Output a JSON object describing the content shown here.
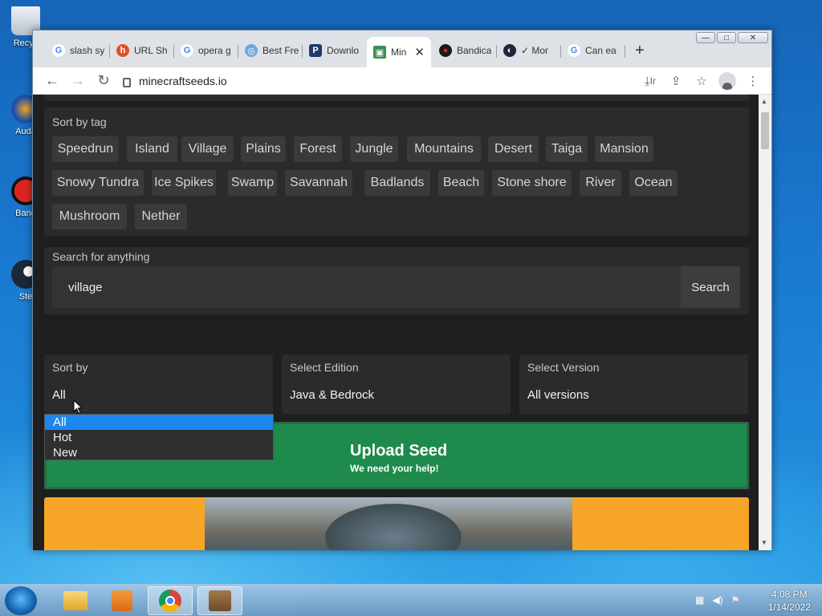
{
  "desktop": {
    "icons": [
      {
        "label": "Recyc",
        "color": "#dfe6ee"
      },
      {
        "label": "Auda",
        "color": "#1c4fa8"
      },
      {
        "label": "Band",
        "color": "#d8261f"
      },
      {
        "label": "Ste",
        "color": "#1b2838"
      }
    ]
  },
  "browser": {
    "tabs": [
      {
        "title": "slash sy",
        "icon": "google-icon",
        "glyph": "G",
        "color": "#ffffff",
        "fg": "#4285f4"
      },
      {
        "title": "URL Sh",
        "icon": "url-shortener-icon",
        "glyph": "h",
        "color": "#e0502a",
        "fg": "#ffffff"
      },
      {
        "title": "opera g",
        "icon": "google-icon",
        "glyph": "G",
        "color": "#ffffff",
        "fg": "#4285f4"
      },
      {
        "title": "Best Fre",
        "icon": "globe-icon",
        "glyph": "◎",
        "color": "#6aa6df",
        "fg": "#ffffff"
      },
      {
        "title": "Downlo",
        "icon": "pdf-icon",
        "glyph": "P",
        "color": "#1f3a6b",
        "fg": "#ffffff"
      },
      {
        "title": "Min",
        "icon": "minecraft-icon",
        "glyph": "▣",
        "color": "#3a8f55",
        "fg": "#ffffff",
        "active": true
      },
      {
        "title": "Bandica",
        "icon": "record-icon",
        "glyph": "●",
        "color": "#1a1a1a",
        "fg": "#e02020"
      },
      {
        "title": "✓ Mor",
        "icon": "steam-icon",
        "glyph": "◐",
        "color": "#1b2838",
        "fg": "#ffffff"
      },
      {
        "title": "Can ea",
        "icon": "google-icon",
        "glyph": "G",
        "color": "#ffffff",
        "fg": "#4285f4"
      }
    ],
    "newtab": "+",
    "window_controls": {
      "min": "—",
      "max": "□",
      "close": "✕"
    },
    "url": "minecraftseeds.io",
    "toolbar": {
      "back": "←",
      "forward": "→",
      "reload": "↻",
      "install": "⤓",
      "install_text": "Ir",
      "share": "⇪",
      "star": "☆",
      "menu": "⋮"
    }
  },
  "page": {
    "tags": {
      "label": "Sort by tag",
      "items": [
        "Speedrun",
        "Island",
        "Village",
        "Plains",
        "Forest",
        "Jungle",
        "Mountains",
        "Desert",
        "Taiga",
        "Mansion",
        "Snowy Tundra",
        "Ice Spikes",
        "Swamp",
        "Savannah",
        "Badlands",
        "Beach",
        "Stone shore",
        "River",
        "Ocean",
        "Mushroom",
        "Nether"
      ]
    },
    "search": {
      "label": "Search for anything",
      "value": "village",
      "button": "Search"
    },
    "sort_by": {
      "label": "Sort by",
      "value": "All",
      "options": [
        "All",
        "Hot",
        "New"
      ],
      "selected": "All"
    },
    "edition": {
      "label": "Select Edition",
      "value": "Java & Bedrock"
    },
    "version": {
      "label": "Select Version",
      "value": "All versions"
    },
    "upload": {
      "title": "Upload Seed",
      "subtitle": "We need your help!"
    },
    "colors": {
      "accent_green": "#1e8a4c",
      "orange": "#f7a526",
      "select_highlight": "#1e86f0"
    }
  },
  "taskbar": {
    "time": "4:08 PM",
    "date": "1/14/2022"
  }
}
